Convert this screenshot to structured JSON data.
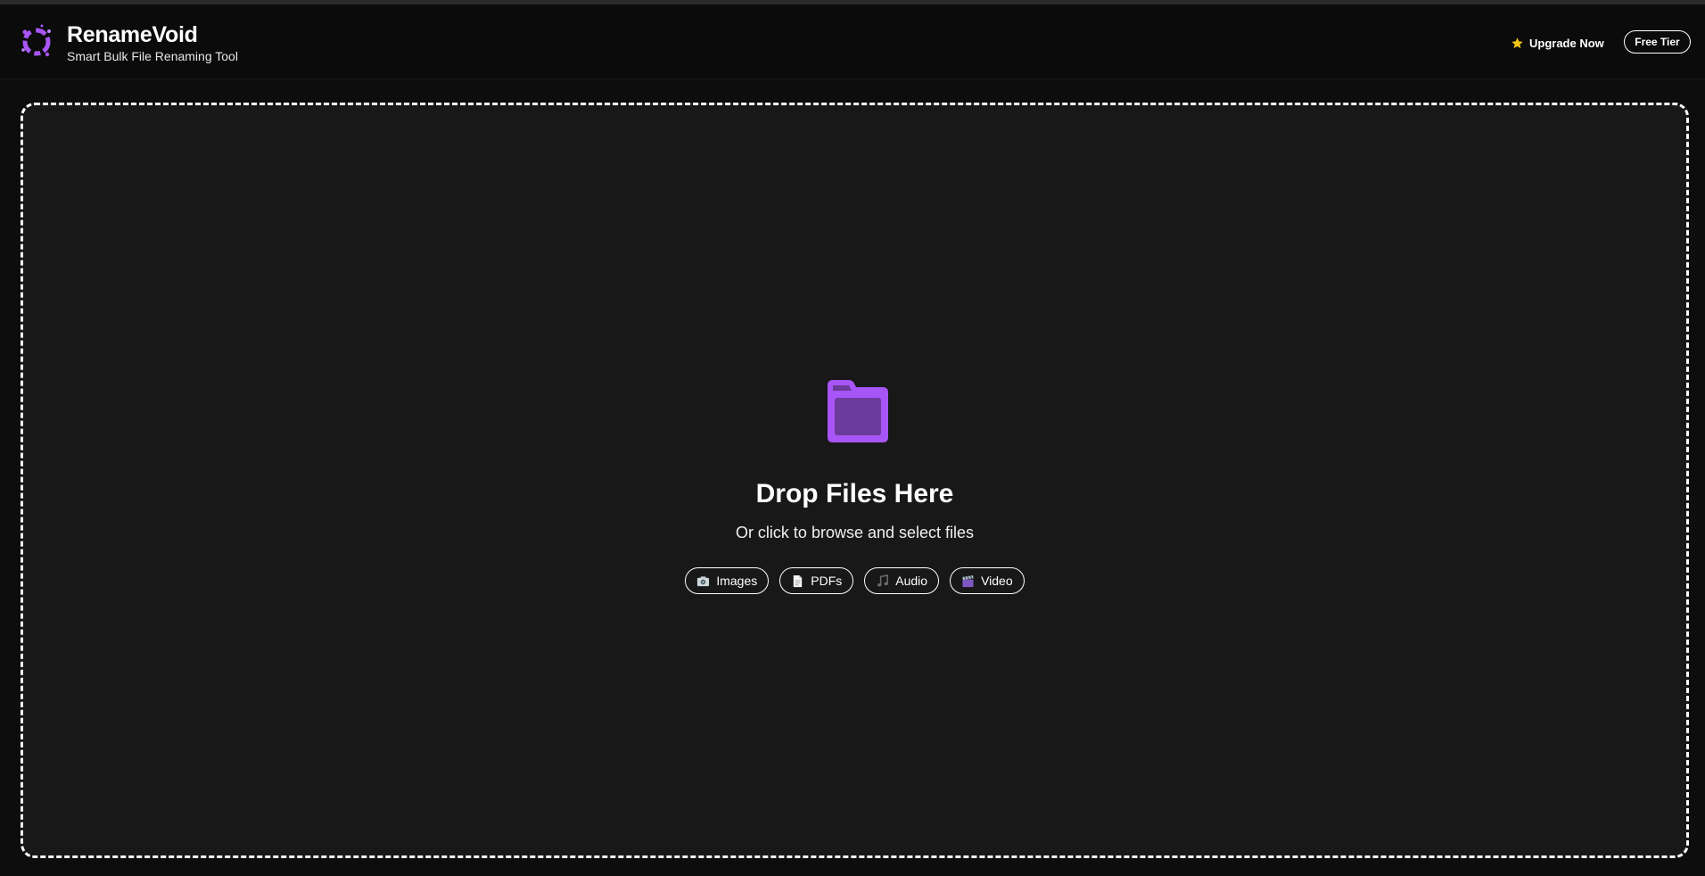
{
  "app": {
    "title": "RenameVoid",
    "subtitle": "Smart Bulk File Renaming Tool"
  },
  "header": {
    "upgrade_label": "Upgrade Now",
    "tier_badge": "Free Tier"
  },
  "dropzone": {
    "icon": "folder-icon",
    "title": "Drop Files Here",
    "subtitle": "Or click to browse and select files",
    "file_types": [
      {
        "label": "Images",
        "icon": "camera-icon"
      },
      {
        "label": "PDFs",
        "icon": "document-icon"
      },
      {
        "label": "Audio",
        "icon": "music-note-icon"
      },
      {
        "label": "Video",
        "icon": "clapperboard-icon"
      }
    ]
  },
  "colors": {
    "accent": "#a855f7",
    "accent_dark": "#6b3a9a",
    "background": "#0d0d0d",
    "panel": "#181818",
    "star": "#f5c518"
  }
}
